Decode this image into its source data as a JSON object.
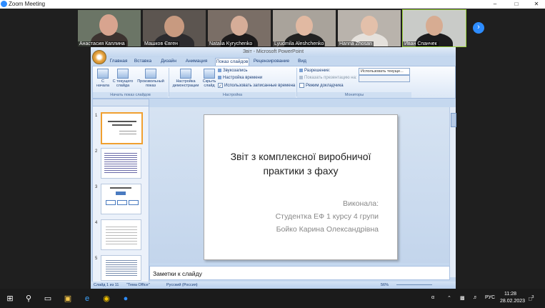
{
  "zoom": {
    "title": "Zoom Meeting",
    "participants": [
      {
        "name": "Анастасия Каплина"
      },
      {
        "name": "Машков Євген"
      },
      {
        "name": "Natalia Kyrychenko"
      },
      {
        "name": "Lyudmila Aleshchenko"
      },
      {
        "name": "Hanna Zhosan"
      },
      {
        "name": "Иван Спанчек"
      }
    ],
    "next_icon": "chevron-right-icon"
  },
  "ppt": {
    "title": "Звіт - Microsoft PowerPoint",
    "tabs": [
      "Главная",
      "Вставка",
      "Дизайн",
      "Анимация",
      "Показ слайдов",
      "Рецензирование",
      "Вид"
    ],
    "ribbon": {
      "btn_from_start": "С начала",
      "btn_from_current": "С текущего слайда",
      "btn_custom": "Произвольный показ",
      "group_start": "Начать показ слайдов",
      "btn_setup": "Настройка демонстрации",
      "btn_hide": "Скрыть слайд",
      "opt_record": "Звукозапись",
      "opt_timing": "Настройка времени",
      "opt_use_timing": "Использовать записанные времена",
      "group_setup": "Настройка",
      "resolution_label": "Разрешение:",
      "resolution_value": "Использовать текуще...",
      "show_on_label": "Показать презентацию на:",
      "presenter_view": "Режим докладчика",
      "group_monitors": "Мониторы"
    },
    "thumbnails": [
      "1",
      "2",
      "3",
      "4",
      "5"
    ],
    "slide": {
      "title": "Звіт з комплексної виробничої практики з фаху",
      "line1": "Виконала:",
      "line2": "Студентка ЕФ 1 курсу 4 групи",
      "line3": "Бойко Карина Олександрівна"
    },
    "notes_placeholder": "Заметки к слайду",
    "status": {
      "slide_count": "Слайд 1 из 11",
      "theme": "\"Тема Office\"",
      "language": "Русский (Россия)",
      "zoom": "56%"
    }
  },
  "taskbar": {
    "language": "РУС",
    "time": "11:28",
    "date": "28.02.2023",
    "notifications": "3"
  }
}
